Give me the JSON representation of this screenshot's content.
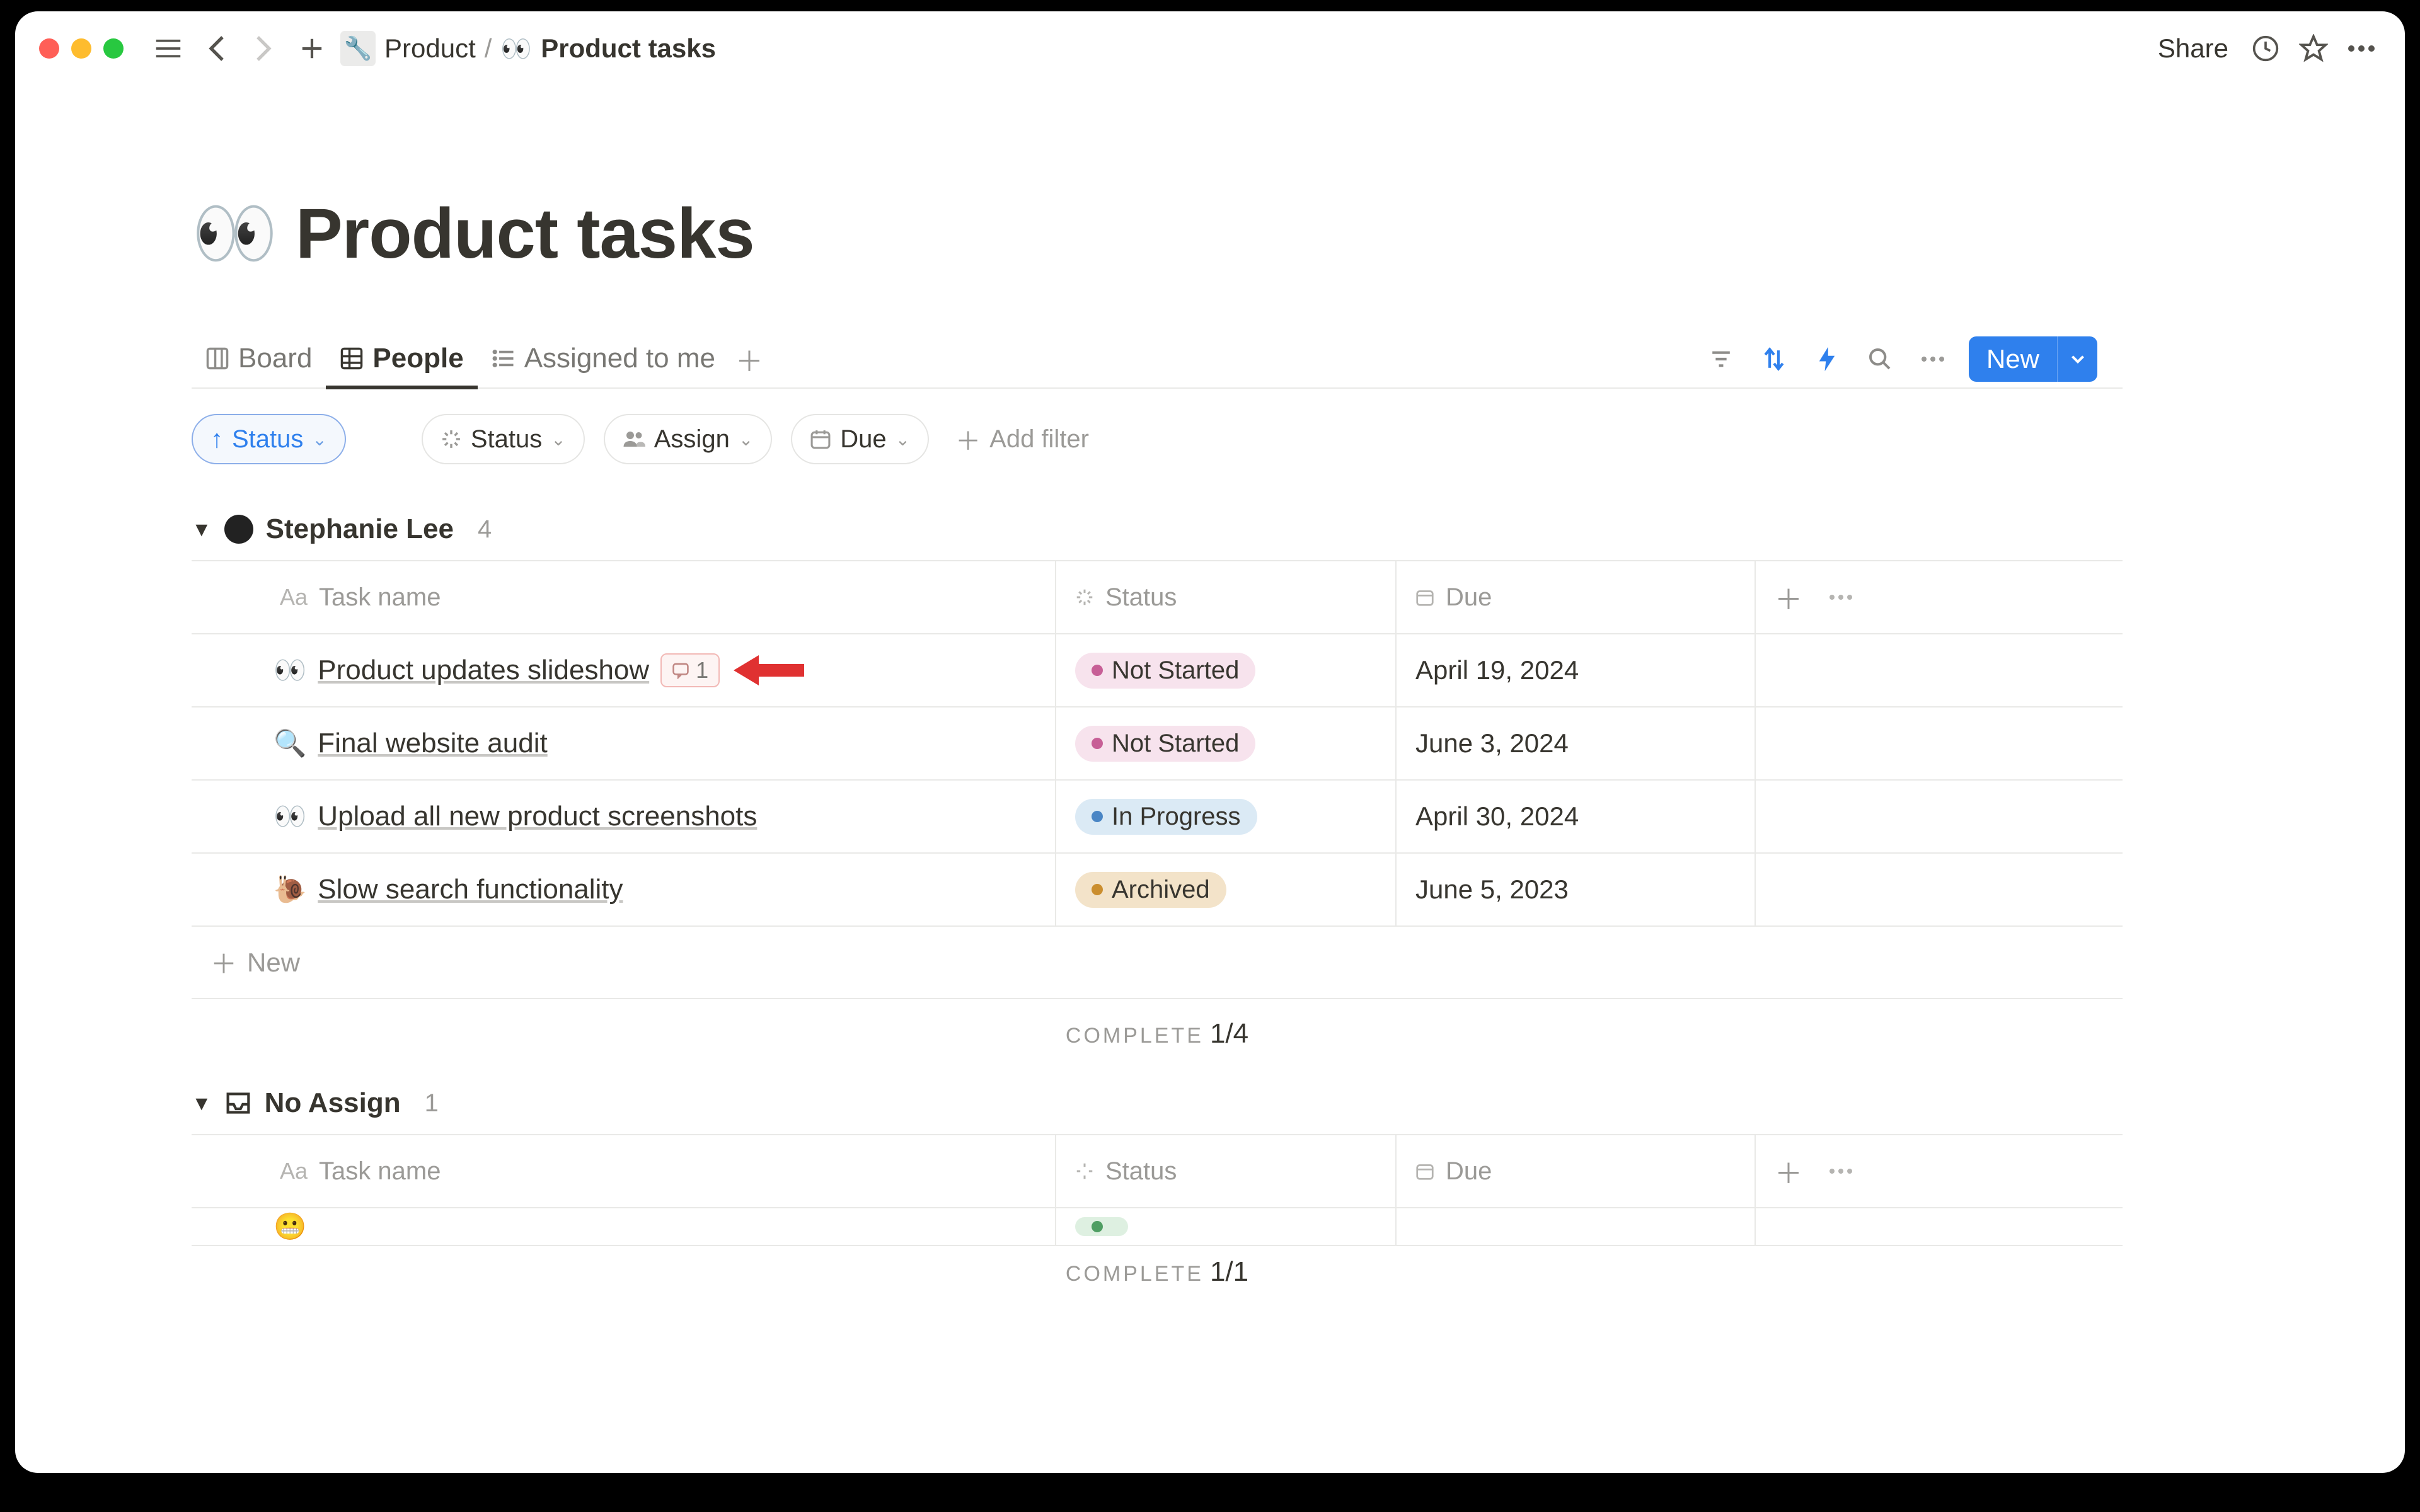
{
  "breadcrumb": {
    "parent_icon": "🔧",
    "parent": "Product",
    "sep": "/",
    "page_icon": "👀",
    "page": "Product tasks"
  },
  "topbar": {
    "share": "Share"
  },
  "page": {
    "icon": "👀",
    "title": "Product tasks"
  },
  "views": {
    "items": [
      {
        "icon": "board",
        "label": "Board"
      },
      {
        "icon": "table",
        "label": "People"
      },
      {
        "icon": "list",
        "label": "Assigned to me"
      }
    ],
    "active_index": 1,
    "new_button": "New"
  },
  "chips": {
    "sort": {
      "arrow": "↑",
      "label": "Status"
    },
    "status": {
      "label": "Status"
    },
    "assign": {
      "label": "Assign"
    },
    "due": {
      "label": "Due"
    },
    "add_filter": "Add filter"
  },
  "columns": {
    "task": "Task name",
    "status": "Status",
    "due": "Due"
  },
  "groups": [
    {
      "name": "Stephanie Lee",
      "count": "4",
      "avatar": true,
      "rows": [
        {
          "emoji": "👀",
          "name": "Product updates slideshow",
          "comments": "1",
          "status": "Not Started",
          "status_class": "sp-notstarted",
          "due": "April 19, 2024",
          "callout_arrow": true
        },
        {
          "emoji": "🔍",
          "name": "Final website audit",
          "status": "Not Started",
          "status_class": "sp-notstarted",
          "due": "June 3, 2024"
        },
        {
          "emoji": "👀",
          "name": "Upload all new product screenshots",
          "status": "In Progress",
          "status_class": "sp-inprogress",
          "due": "April 30, 2024"
        },
        {
          "emoji": "🐌",
          "name": "Slow search functionality",
          "status": "Archived",
          "status_class": "sp-archived",
          "due": "June 5, 2023"
        }
      ],
      "new_row": "New",
      "complete_label": "COMPLETE",
      "complete_value": "1/4"
    },
    {
      "name": "No Assign",
      "count": "1",
      "inbox": true,
      "rows": [
        {
          "emoji": "😬",
          "name": "",
          "status": "",
          "status_class": "sp-done",
          "due": ""
        }
      ],
      "complete_label": "COMPLETE",
      "complete_value": "1/1"
    }
  ]
}
